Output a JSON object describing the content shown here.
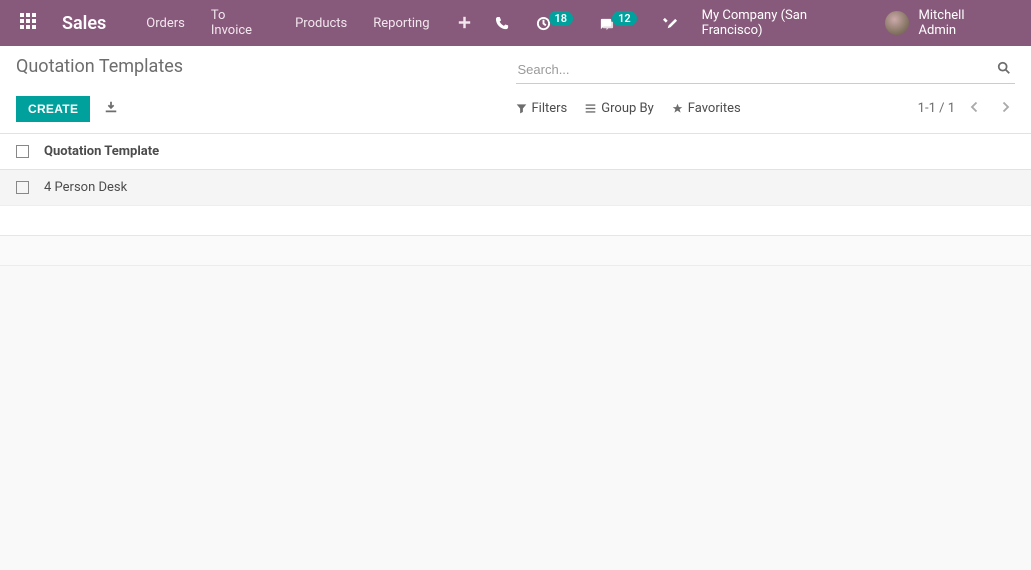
{
  "navbar": {
    "brand": "Sales",
    "menu": [
      "Orders",
      "To Invoice",
      "Products",
      "Reporting"
    ],
    "activity_count": "18",
    "message_count": "12",
    "company": "My Company (San Francisco)",
    "user": "Mitchell Admin"
  },
  "breadcrumb": "Quotation Templates",
  "search": {
    "placeholder": "Search..."
  },
  "toolbar": {
    "create_label": "CREATE"
  },
  "filters": {
    "filters_label": "Filters",
    "groupby_label": "Group By",
    "favorites_label": "Favorites"
  },
  "pager": {
    "range": "1-1 / 1"
  },
  "list": {
    "header": "Quotation Template",
    "rows": [
      {
        "name": "4 Person Desk"
      }
    ]
  }
}
